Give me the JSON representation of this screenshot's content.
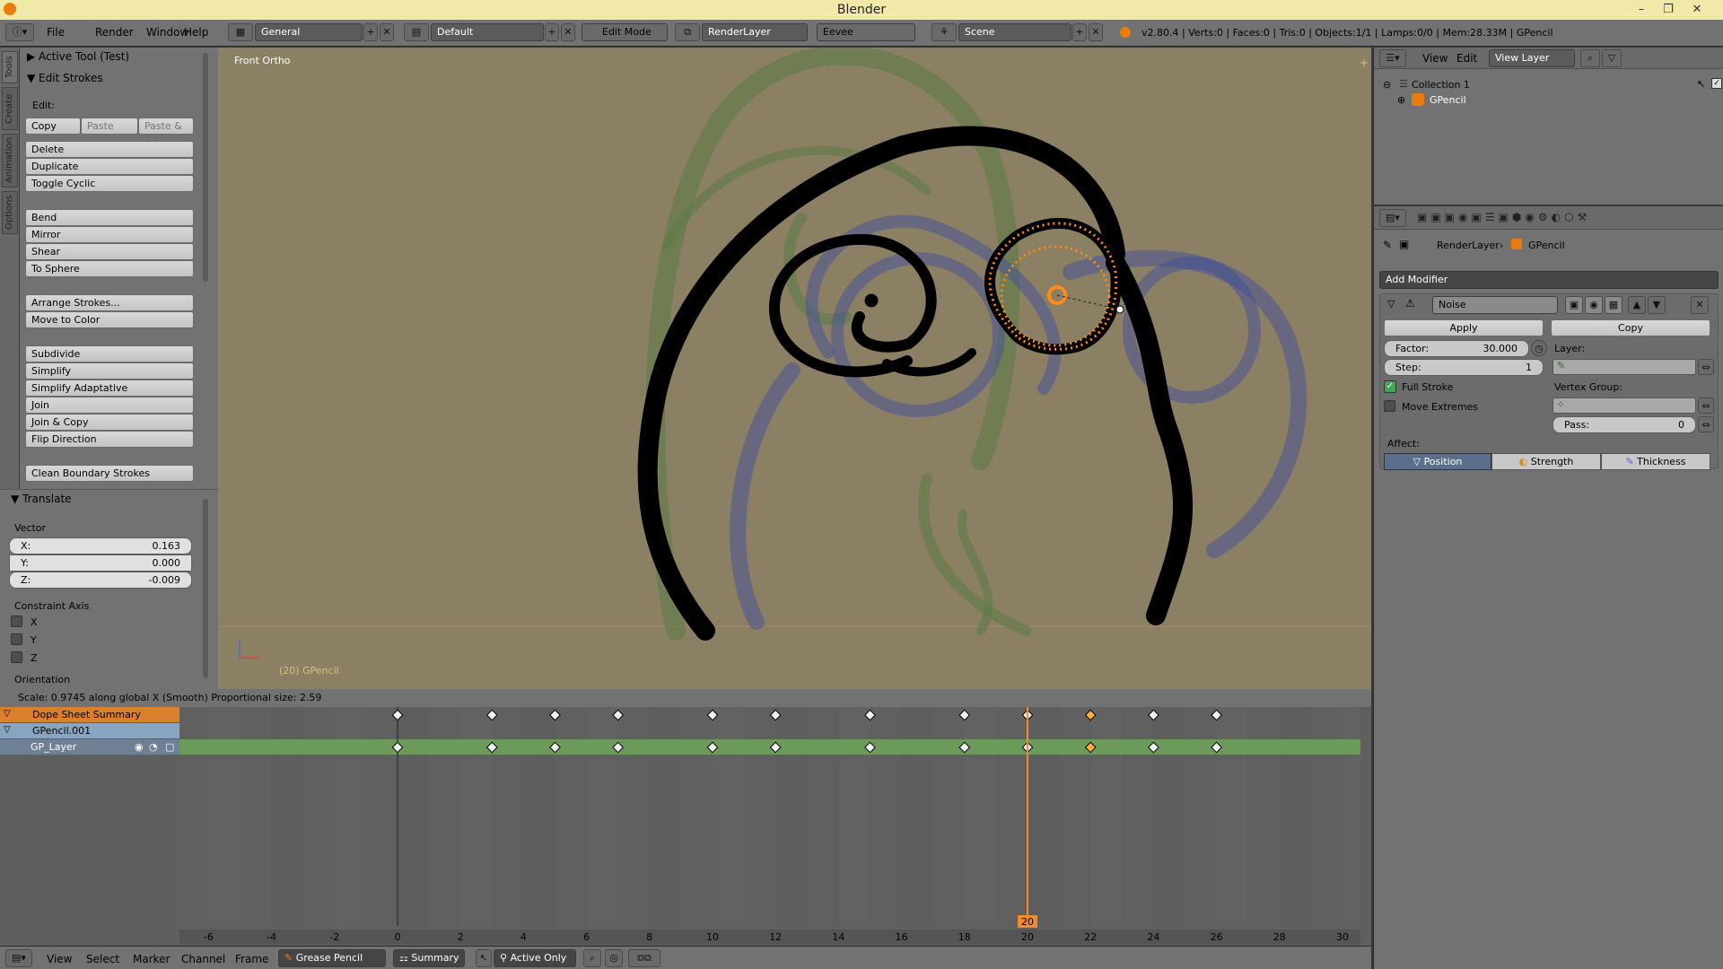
{
  "window": {
    "title": "Blender",
    "minimize": "–",
    "maximize": "❐",
    "close": "✕"
  },
  "topbar": {
    "menus": [
      "File",
      "Render",
      "Window",
      "Help"
    ],
    "workspace": "General",
    "screen": "Default",
    "mode": "Edit Mode",
    "render_layer": "RenderLayer",
    "engine": "Eevee",
    "scene": "Scene",
    "stats": "v2.80.4 | Verts:0 | Faces:0 | Tris:0 | Objects:1/1 | Lamps:0/0 | Mem:28.33M | GPencil"
  },
  "tool_tabs": [
    "Tools",
    "Create",
    "Animation",
    "Options"
  ],
  "tool_panel": {
    "active_tool": "Active Tool (Test)",
    "edit_strokes": "Edit Strokes",
    "edit_label": "Edit:",
    "copy": "Copy",
    "paste": "Paste",
    "paste_m": "Paste & M",
    "group1": [
      "Delete",
      "Duplicate",
      "Toggle Cyclic"
    ],
    "group2": [
      "Bend",
      "Mirror",
      "Shear",
      "To Sphere"
    ],
    "arrange": "Arrange Strokes...",
    "move_to_color": "Move to Color",
    "group3": [
      "Subdivide",
      "Simplify",
      "Simplify Adaptative",
      "Join",
      "Join & Copy",
      "Flip Direction"
    ],
    "clean": "Clean Boundary Strokes",
    "translate": "Translate",
    "vector_label": "Vector",
    "x_label": "X:",
    "x_value": "0.163",
    "y_label": "Y:",
    "y_value": "0.000",
    "z_label": "Z:",
    "z_value": "-0.009",
    "constraint_label": "Constraint Axis",
    "axes": [
      "X",
      "Y",
      "Z"
    ],
    "orientation": "Orientation"
  },
  "op_status": "Scale: 0.9745 along global X (Smooth) Proportional size: 2.59",
  "viewport": {
    "view_label": "Front Ortho",
    "object_label": "(20) GPencil"
  },
  "outliner": {
    "menus": [
      "View",
      "Edit"
    ],
    "view_layer": "View Layer",
    "collection": "Collection 1",
    "object": "GPencil"
  },
  "properties": {
    "breadcrumb_layer": "RenderLayer",
    "breadcrumb_object": "GPencil",
    "add_modifier": "Add Modifier",
    "modifier_name": "Noise",
    "apply": "Apply",
    "copy": "Copy",
    "factor_label": "Factor:",
    "factor_value": "30.000",
    "step_label": "Step:",
    "step_value": "1",
    "layer_label": "Layer:",
    "full_stroke": "Full Stroke",
    "move_extremes": "Move Extremes",
    "vertex_group_label": "Vertex Group:",
    "pass_label": "Pass:",
    "pass_value": "0",
    "affect_label": "Affect:",
    "affect": [
      "Position",
      "Strength",
      "Thickness"
    ]
  },
  "dopesheet": {
    "summary": "Dope Sheet Summary",
    "object": "GPencil.001",
    "layer": "GP_Layer",
    "current_frame": "20",
    "ruler": [
      "-6",
      "-4",
      "-2",
      "0",
      "2",
      "4",
      "6",
      "8",
      "10",
      "12",
      "14",
      "16",
      "18",
      "20",
      "22",
      "24",
      "26",
      "28",
      "30"
    ],
    "keyframes": [
      0,
      3,
      5,
      7,
      10,
      12,
      15,
      18,
      20,
      22,
      24,
      26
    ],
    "selected_keyframe": 22
  },
  "dopesheet_header": {
    "menus": [
      "View",
      "Select",
      "Marker",
      "Channel",
      "Frame"
    ],
    "mode": "Grease Pencil",
    "summary": "Summary",
    "active_only": "Active Only"
  },
  "colors": {
    "accent": "#e87d0d",
    "viewport_bg": "#8b8064",
    "selected": "#ff8c1a"
  }
}
